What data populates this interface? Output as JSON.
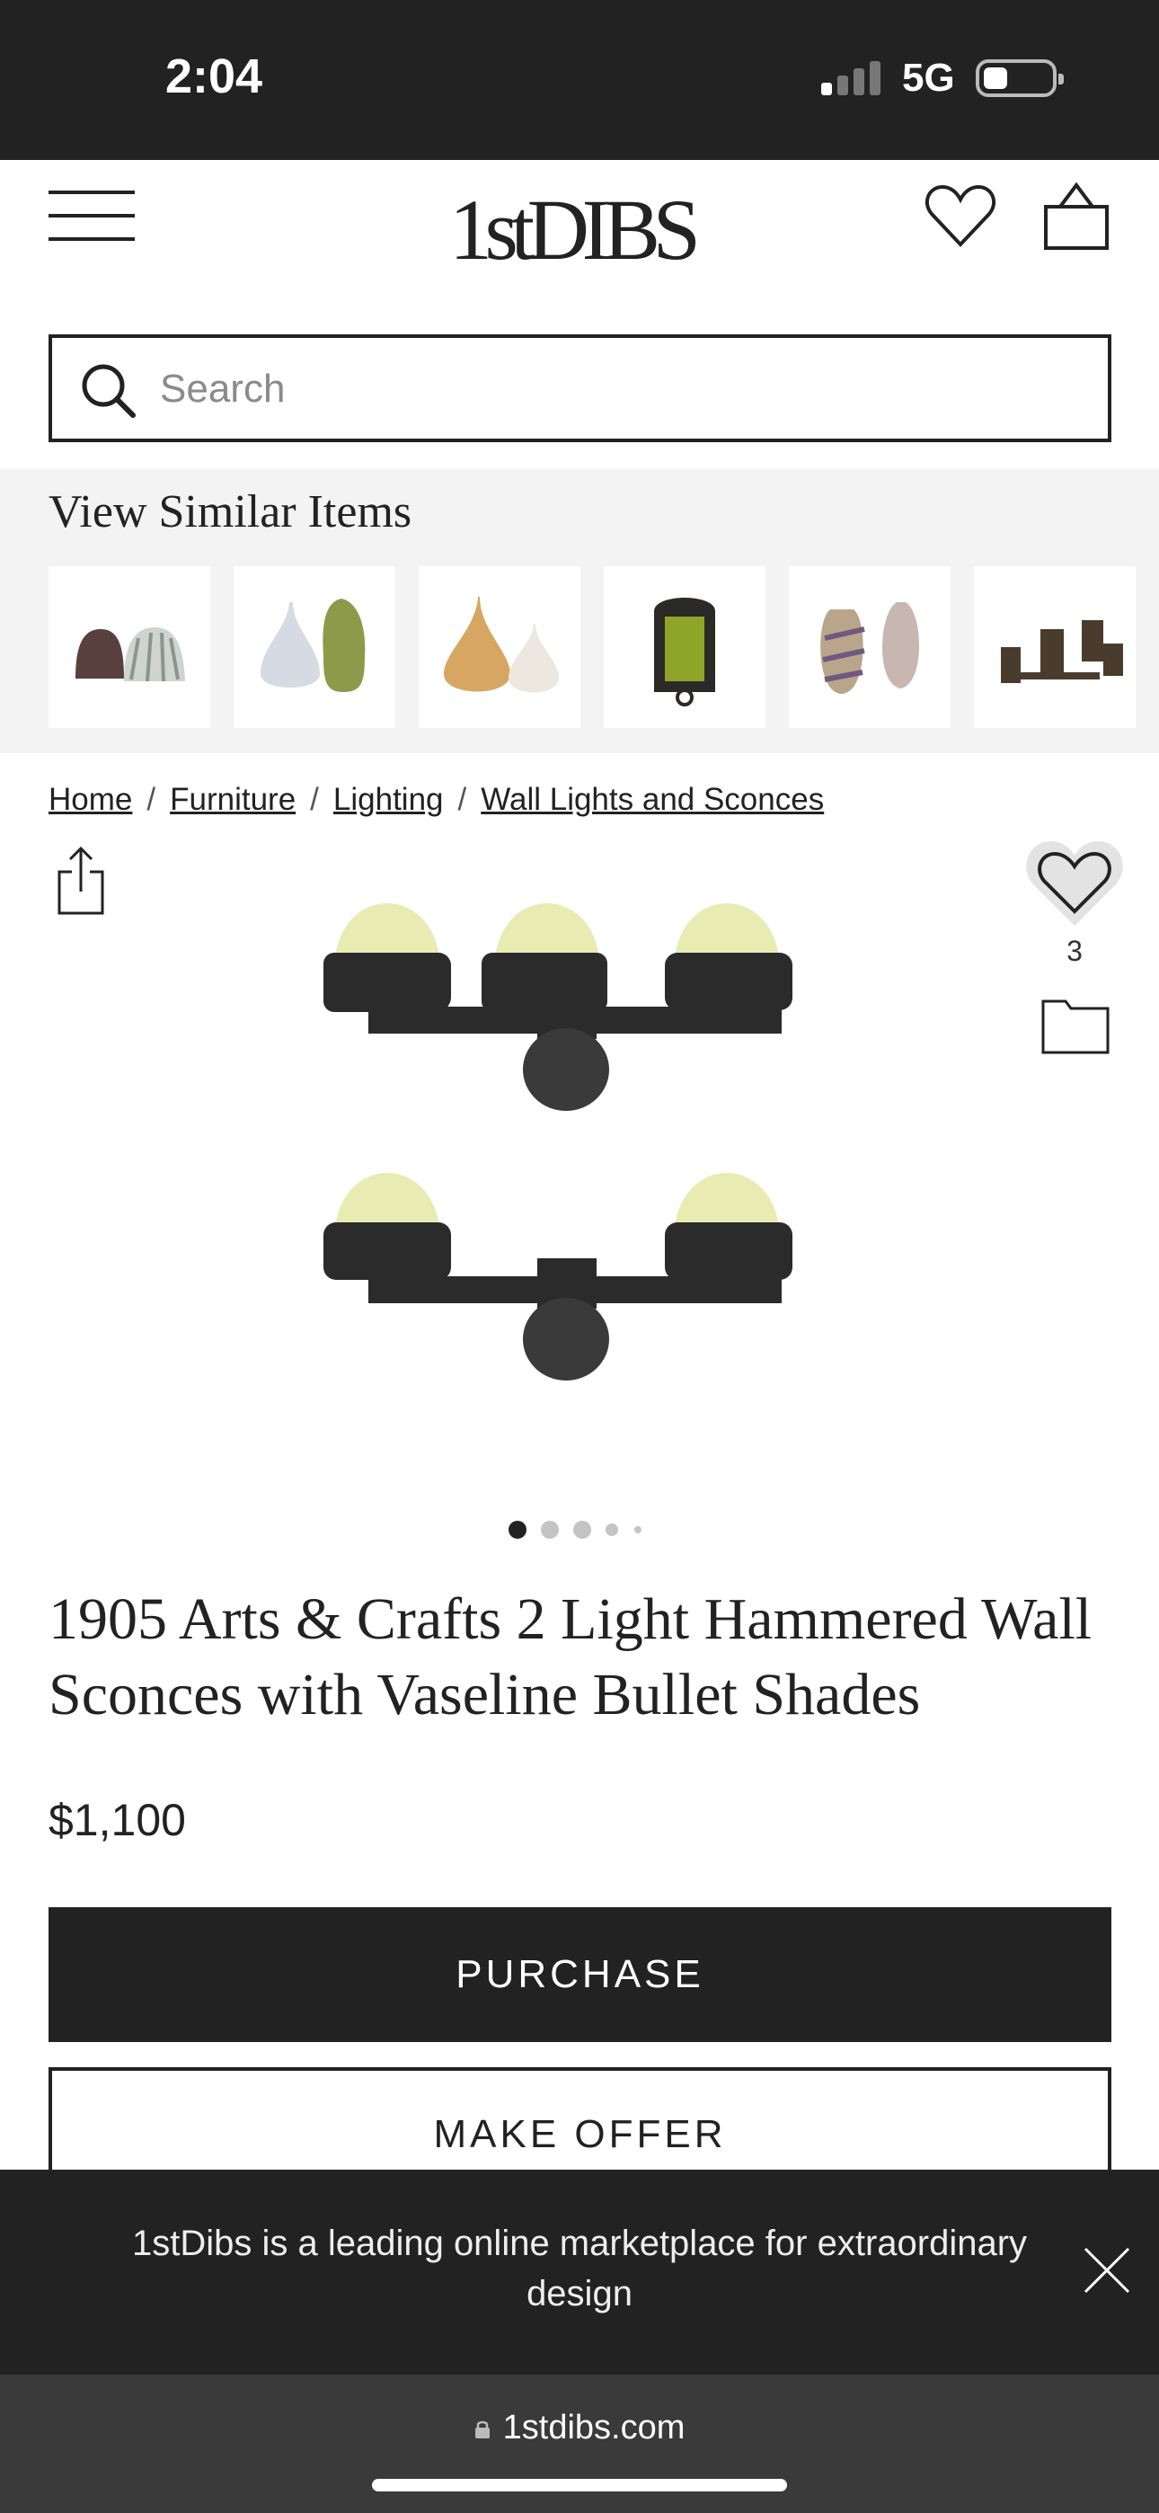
{
  "status_bar": {
    "time": "2:04",
    "network": "5G",
    "signal_bars_active": 1,
    "signal_bars_total": 4
  },
  "header": {
    "logo_text": "1stDIBS"
  },
  "search": {
    "placeholder": "Search"
  },
  "similar": {
    "heading": "View Similar Items",
    "thumbs": [
      {
        "name": "bell-shades"
      },
      {
        "name": "iridescent-shades"
      },
      {
        "name": "amber-teardrop-shades"
      },
      {
        "name": "green-lantern"
      },
      {
        "name": "swirl-shades"
      },
      {
        "name": "bronze-sconces"
      }
    ]
  },
  "breadcrumbs": {
    "items": [
      "Home",
      "Furniture",
      "Lighting",
      "Wall Lights and Sconces"
    ],
    "separator": "/"
  },
  "product": {
    "favorite_count": "3",
    "image_index": 1,
    "image_total": 5,
    "title": "1905 Arts & Crafts 2 Light Hammered Wall Sconces with Vaseline Bullet Shades",
    "price": "$1,100",
    "purchase_label": "PURCHASE",
    "offer_label": "MAKE OFFER"
  },
  "banner": {
    "text": "1stDibs is a leading online marketplace for extraordinary design"
  },
  "browser": {
    "url": "1stdibs.com"
  },
  "colors": {
    "dark": "#222222",
    "shade": "#e9ecb2",
    "iron": "#2b2b2b"
  }
}
